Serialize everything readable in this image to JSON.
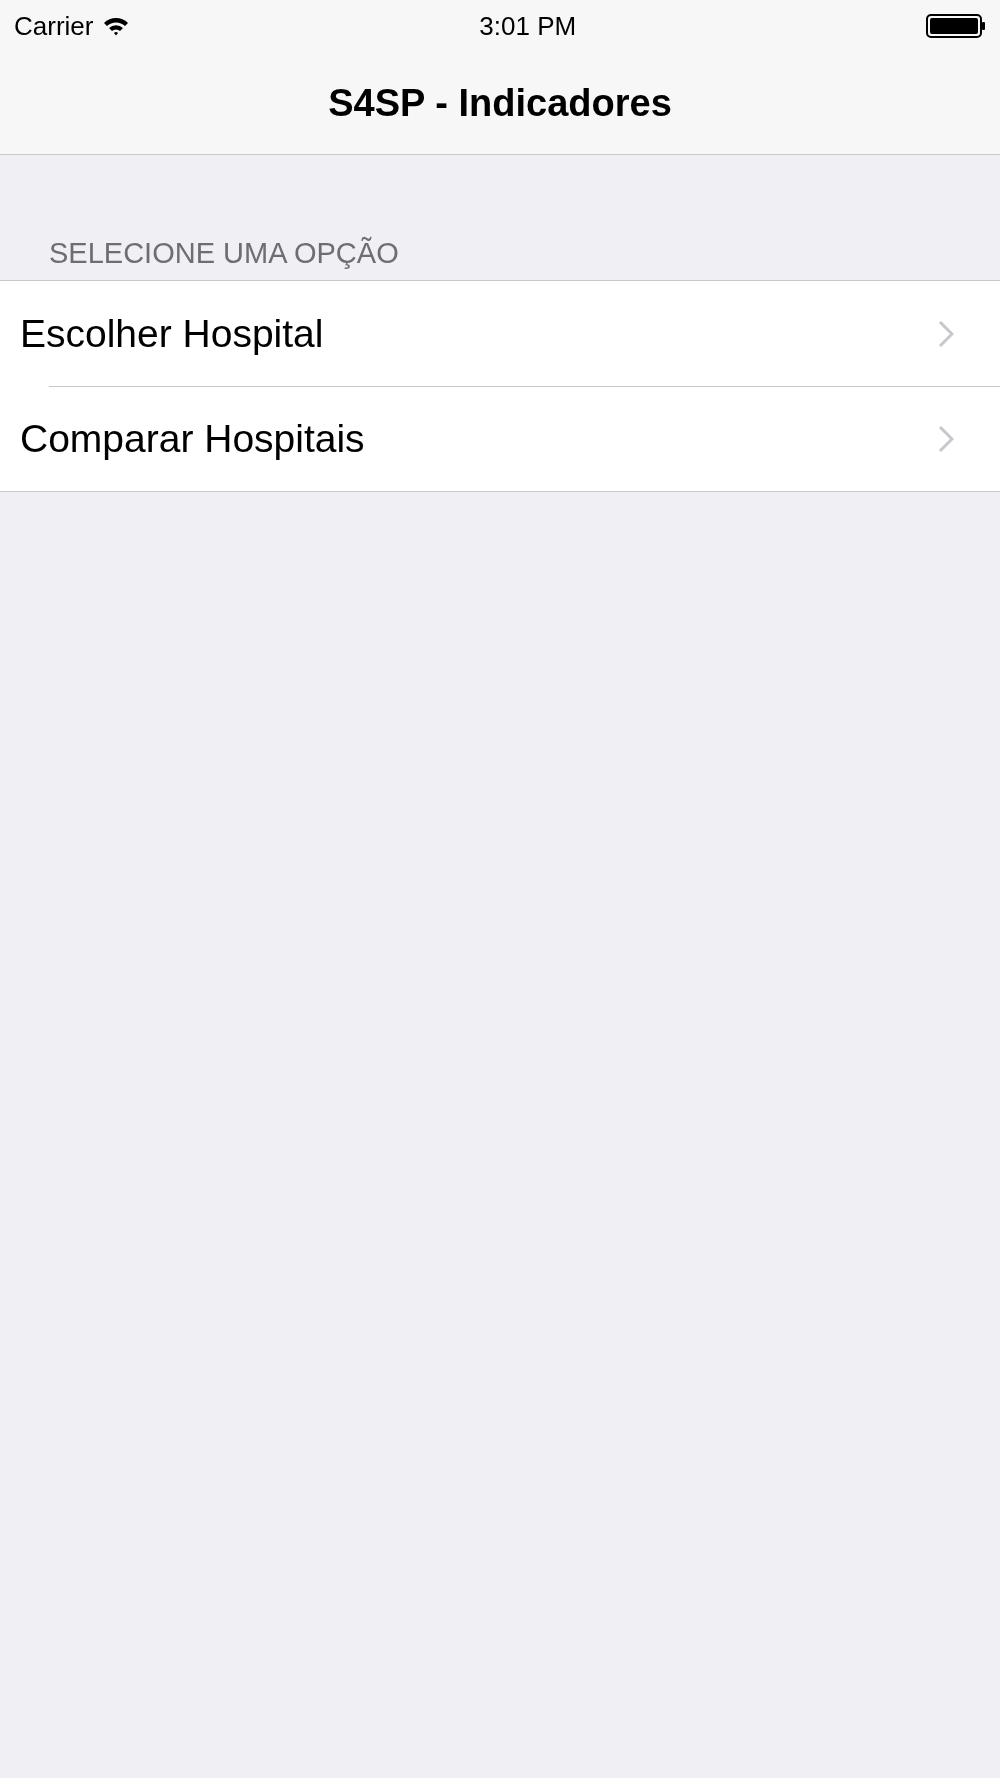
{
  "status_bar": {
    "carrier": "Carrier",
    "time": "3:01 PM"
  },
  "nav_bar": {
    "title": "S4SP - Indicadores"
  },
  "section": {
    "header": "SELECIONE UMA OPÇÃO",
    "items": [
      {
        "label": "Escolher Hospital"
      },
      {
        "label": "Comparar Hospitais"
      }
    ]
  }
}
